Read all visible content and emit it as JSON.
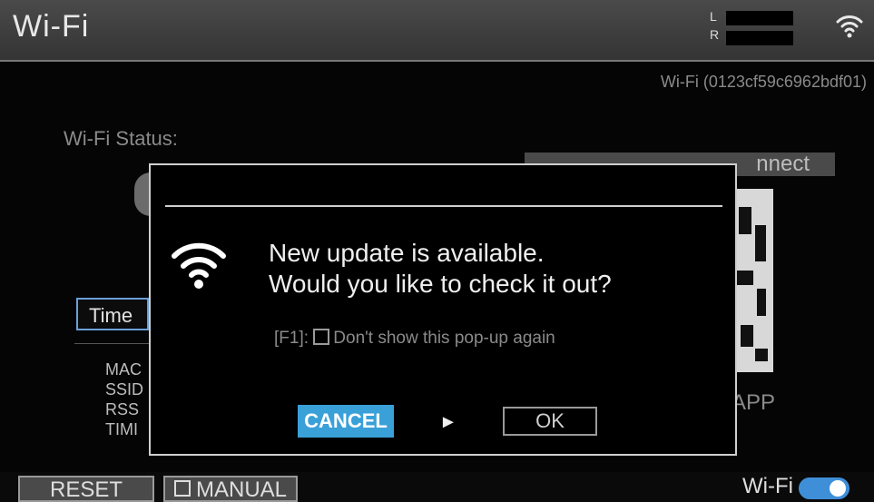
{
  "header": {
    "title": "Wi-Fi",
    "meter_left": "L",
    "meter_right": "R"
  },
  "background": {
    "device_id": "Wi-Fi (0123cf59c6962bdf01)",
    "status_label": "Wi-Fi Status:",
    "cloud_connect": "nnect",
    "time_tab": "Time",
    "info_labels": [
      "MAC",
      "SSID",
      "RSS",
      "TIMI"
    ],
    "app_partial": "APP"
  },
  "modal": {
    "message_line1": "New update is available.",
    "message_line2": "Would you like to check it out?",
    "option_key": "[F1]:",
    "option_label": "Don't show this pop-up again",
    "cancel_label": "CANCEL",
    "arrow": "►",
    "ok_label": "OK"
  },
  "footer": {
    "reset_label": "RESET",
    "manual_label": "MANUAL",
    "wifi_toggle_label": "Wi-Fi",
    "wifi_toggle_on": true
  },
  "colors": {
    "accent": "#3aa0d8",
    "selected_border": "#6aa0d8"
  }
}
